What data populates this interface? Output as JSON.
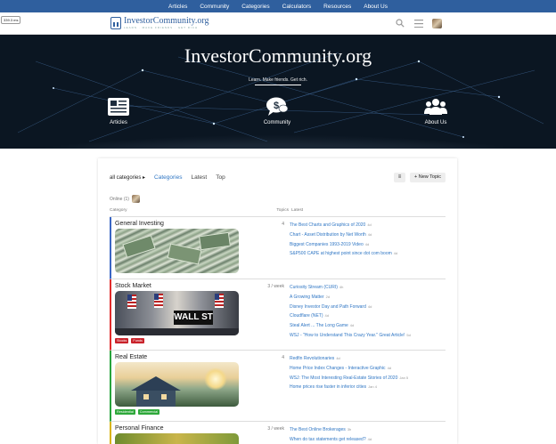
{
  "topnav": [
    "Articles",
    "Community",
    "Categories",
    "Calculators",
    "Resources",
    "About Us"
  ],
  "badge": "339.3 ms",
  "logo": {
    "title": "InvestorCommunity.org",
    "subtitle": "LEARN · MAKE FRIENDS · GET RICH"
  },
  "hero": {
    "title": "InvestorCommunity.org",
    "subtitle": "Learn. Make friends. Get rich.",
    "items": [
      {
        "label": "Articles",
        "icon": "document-list-icon"
      },
      {
        "label": "Community",
        "icon": "speech-dollar-icon"
      },
      {
        "label": "About Us",
        "icon": "users-icon"
      }
    ]
  },
  "filters": {
    "category_dropdown": "all categories",
    "tabs": [
      "Categories",
      "Latest",
      "Top"
    ],
    "active_tab": "Categories",
    "menu_icon": "≡",
    "new_topic": "New Topic"
  },
  "online": "Online (1)",
  "columns": {
    "category": "Category",
    "topics": "Topics",
    "latest": "Latest"
  },
  "categories": [
    {
      "name": "General Investing",
      "count": "4",
      "color": "#3a66c4",
      "tags": [],
      "topics": [
        {
          "title": "The Best Charts and Graphics of 2020",
          "age": "4d"
        },
        {
          "title": "Chart - Asset Distribution by Net Worth",
          "age": "4d"
        },
        {
          "title": "Biggest Companies 1993-2019 Video",
          "age": "4d"
        },
        {
          "title": "S&P500 CAPE at highest point since dot com boom",
          "age": "4d"
        }
      ]
    },
    {
      "name": "Stock Market",
      "count": "3 / week",
      "color": "#e02c2c",
      "tags": [
        {
          "label": "Stocks",
          "color": "#c9222a"
        },
        {
          "label": "Funds",
          "color": "#c9222a"
        }
      ],
      "topics": [
        {
          "title": "Curiosity Stream (CURI)",
          "age": "4h"
        },
        {
          "title": "A Growing Matter",
          "age": "2d"
        },
        {
          "title": "Disney Investor Day and Path Forward",
          "age": "4d"
        },
        {
          "title": "Cloudflare (NET)",
          "age": "4d"
        },
        {
          "title": "Steal Alert ... The Long Game",
          "age": "4d"
        },
        {
          "title": "WSJ - \"How to Understand This Crazy Year.\" Great Article!",
          "age": "5d"
        }
      ]
    },
    {
      "name": "Real Estate",
      "count": "4",
      "color": "#27a43c",
      "tags": [
        {
          "label": "Residential",
          "color": "#2ea83a"
        },
        {
          "label": "Commercial",
          "color": "#2ea83a"
        }
      ],
      "topics": [
        {
          "title": "Redfin Revolutionaries",
          "age": "4d"
        },
        {
          "title": "Home Price Index Changes - Interactive Graphic",
          "age": "4d"
        },
        {
          "title": "WSJ: The Most Interesting Real-Estate Stories of 2020",
          "age": "Jan 5"
        },
        {
          "title": "Home prices rise faster in inferior cities",
          "age": "Jan 4"
        }
      ]
    },
    {
      "name": "Personal Finance",
      "count": "3 / week",
      "color": "#d9b30d",
      "tags": [],
      "topics": [
        {
          "title": "The Best Online Brokerages",
          "age": "3h"
        },
        {
          "title": "When do tax statements get released?",
          "age": "4d"
        }
      ]
    }
  ]
}
